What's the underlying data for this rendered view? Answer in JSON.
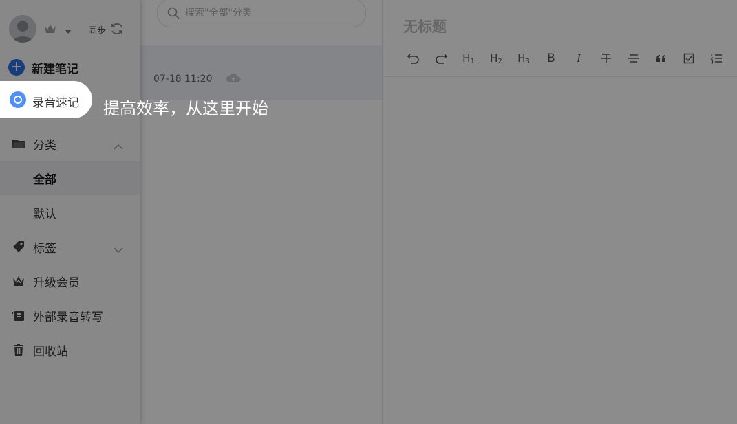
{
  "sidebar": {
    "sync_label": "同步",
    "new_note_label": "新建笔记",
    "record_label": "录音速记",
    "category_label": "分类",
    "categories": [
      "全部",
      "默认"
    ],
    "tags_label": "标签",
    "upgrade_label": "升级会员",
    "external_record_label": "外部录音转写",
    "trash_label": "回收站"
  },
  "list": {
    "search_placeholder": "搜索\"全部\"分类",
    "notes": [
      {
        "timestamp": "07-18 11:20"
      }
    ]
  },
  "editor": {
    "title_placeholder": "无标题",
    "toolbar": {
      "h1": "H",
      "h2": "H",
      "h3": "H",
      "bold": "B",
      "italic": "I"
    }
  },
  "guide": {
    "tip_text": "提高效率，从这里开始"
  },
  "colors": {
    "accent": "#2b6fe6",
    "record_icon": "#4f8ff7",
    "overlay": "rgba(0,0,0,0.45)"
  }
}
